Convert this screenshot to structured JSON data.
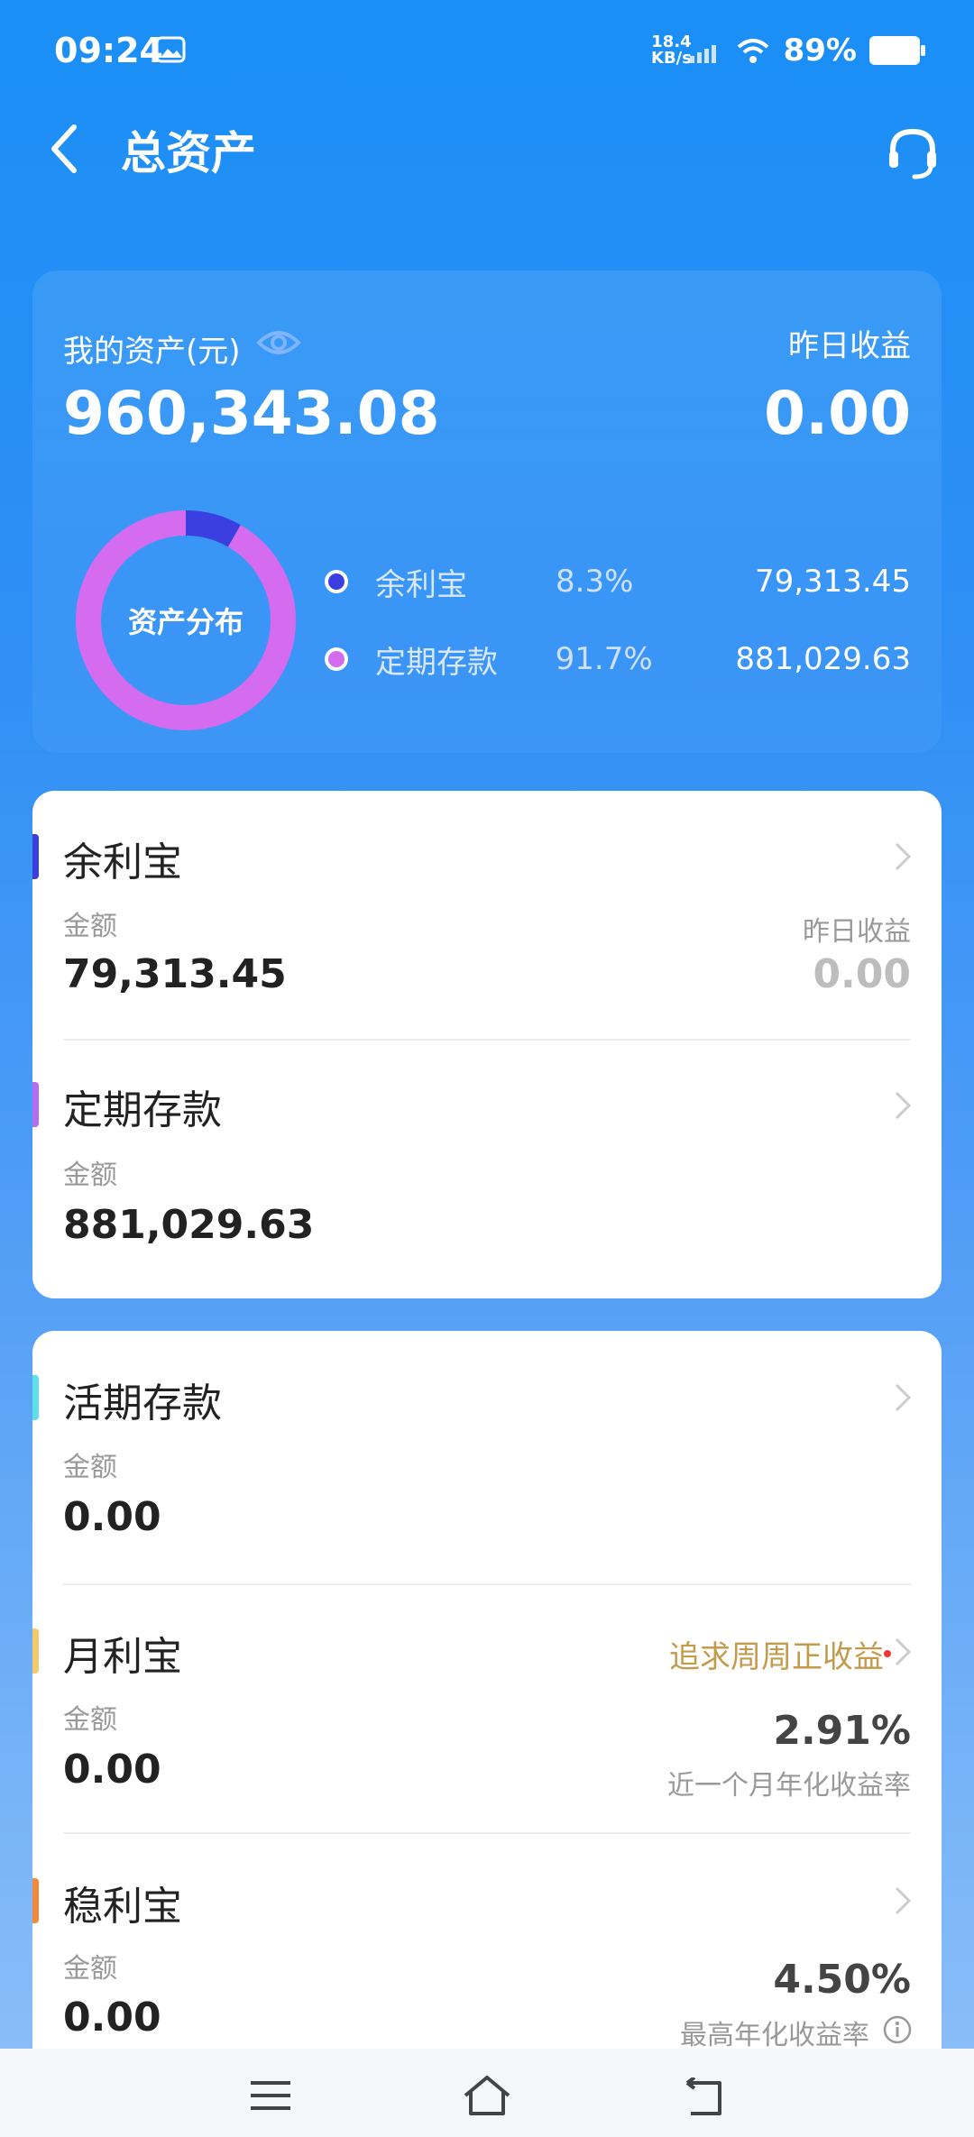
{
  "status": {
    "time": "09:24",
    "net_speed_top": "18.4",
    "net_speed_bottom": "KB/s",
    "battery": "89%"
  },
  "header": {
    "title": "总资产"
  },
  "summary": {
    "asset_label": "我的资产(元)",
    "asset_value": "960,343.08",
    "yesterday_label": "昨日收益",
    "yesterday_value": "0.00",
    "donut_center": "资产分布",
    "distribution": [
      {
        "name": "余利宝",
        "percent": "8.3%",
        "value": "79,313.45",
        "share": 0.083,
        "color": "#3b3fe0"
      },
      {
        "name": "定期存款",
        "percent": "91.7%",
        "value": "881,029.63",
        "share": 0.917,
        "color": "#d56cf0"
      }
    ]
  },
  "card1": {
    "items": [
      {
        "title": "余利宝",
        "amount_label": "金额",
        "amount": "79,313.45",
        "right_label": "昨日收益",
        "right_value": "0.00",
        "bar_color": "#3b3fe0"
      },
      {
        "title": "定期存款",
        "amount_label": "金额",
        "amount": "881,029.63",
        "bar_color": "#b56cf0"
      }
    ]
  },
  "card2": {
    "items": [
      {
        "title": "活期存款",
        "amount_label": "金额",
        "amount": "0.00",
        "bar_color": "#5ee0ea"
      },
      {
        "title": "月利宝",
        "amount_label": "金额",
        "amount": "0.00",
        "promo": "追求周周正收益",
        "rate": "2.91%",
        "rate_label": "近一个月年化收益率",
        "bar_color": "#f3c96b"
      },
      {
        "title": "稳利宝",
        "amount_label": "金额",
        "amount": "0.00",
        "rate": "4.50%",
        "rate_label": "最高年化收益率",
        "bar_color": "#f08a3c"
      }
    ]
  },
  "icons": {
    "back": "chevron-left-icon",
    "support": "headset-icon",
    "eye": "eye-icon",
    "nav": [
      "menu-icon",
      "home-icon",
      "back-icon"
    ]
  }
}
